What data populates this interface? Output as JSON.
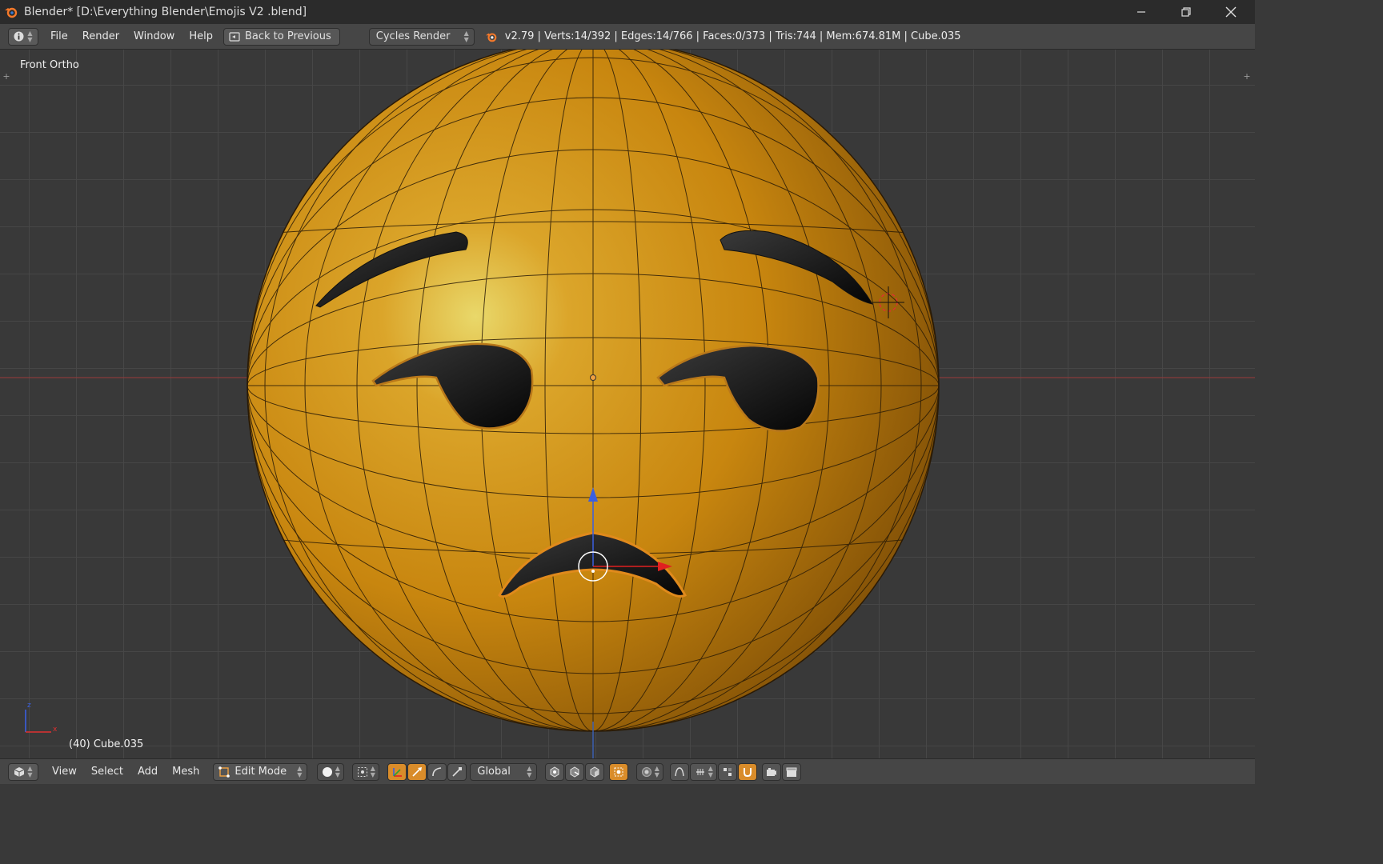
{
  "window": {
    "title": "Blender* [D:\\Everything Blender\\Emojis V2 .blend]"
  },
  "info_header": {
    "menus": [
      "File",
      "Render",
      "Window",
      "Help"
    ],
    "back_button": "Back to Previous",
    "render_engine": "Cycles Render",
    "stats": "v2.79 | Verts:14/392 | Edges:14/766 | Faces:0/373 | Tris:744 | Mem:674.81M | Cube.035"
  },
  "viewport": {
    "view_name": "Front Ortho",
    "active_object": "(40) Cube.035",
    "axis_labels": {
      "z": "z",
      "x": "x"
    }
  },
  "bottom_header": {
    "menus": [
      "View",
      "Select",
      "Add",
      "Mesh"
    ],
    "mode": "Edit Mode",
    "orientation": "Global"
  },
  "colors": {
    "accent": "#d98c2a",
    "mesh_yellow": "#d4920e",
    "grid": "#474747",
    "background": "#393939"
  }
}
